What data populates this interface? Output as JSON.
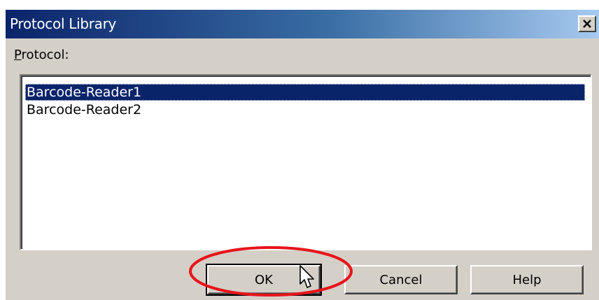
{
  "dialog": {
    "title": "Protocol Library",
    "close_icon": "close-icon"
  },
  "list": {
    "label_mnemonic": "P",
    "label_rest": "rotocol:",
    "items": [
      {
        "label": "Barcode-Reader1",
        "selected": true
      },
      {
        "label": "Barcode-Reader2",
        "selected": false
      }
    ]
  },
  "buttons": {
    "ok": "OK",
    "cancel": "Cancel",
    "help": "Help"
  },
  "annotation": {
    "color": "#e8141b",
    "highlighted": "ok-button"
  },
  "cursor": {
    "icon": "mouse-pointer-icon"
  }
}
